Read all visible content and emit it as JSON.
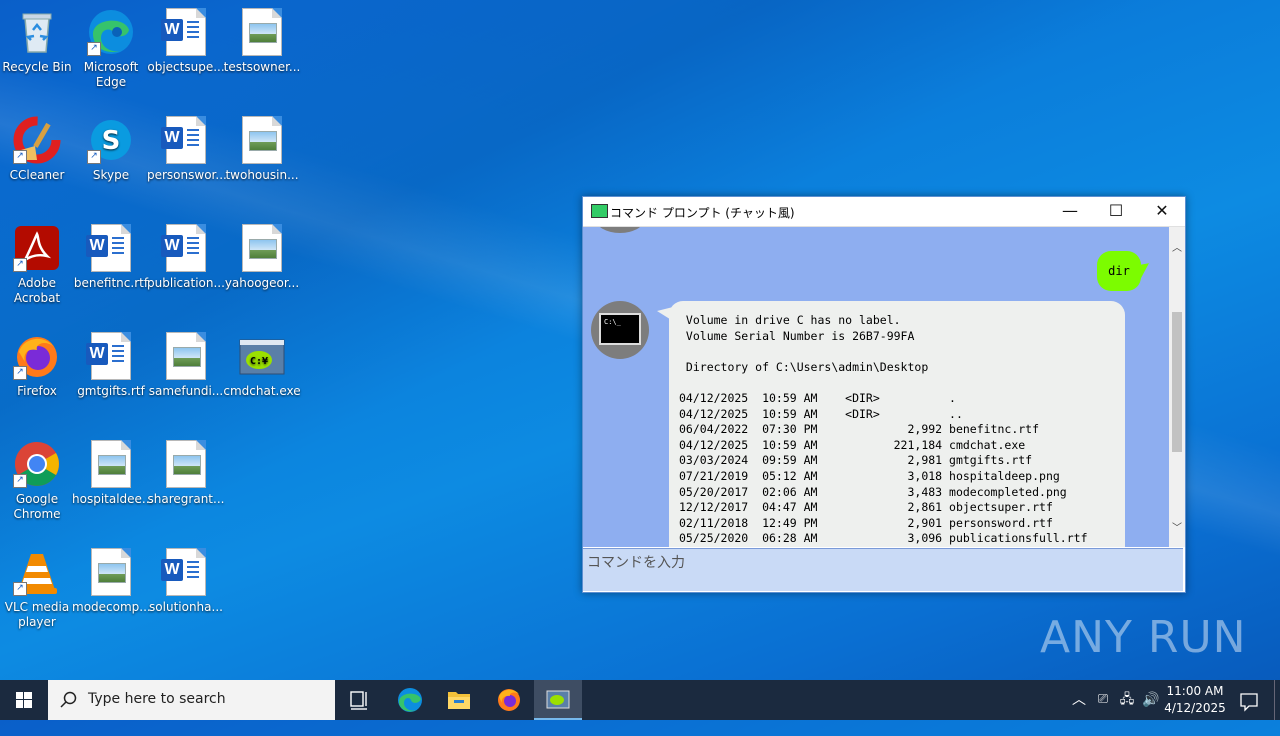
{
  "desktop": {
    "icons": [
      {
        "label": "Recycle Bin",
        "icon": "recycle-bin-icon"
      },
      {
        "label": "Microsoft\nEdge",
        "icon": "edge-icon"
      },
      {
        "label": "objectsupe...",
        "icon": "word-document-icon"
      },
      {
        "label": "testsowner...",
        "icon": "image-file-icon"
      },
      {
        "label": "CCleaner",
        "icon": "ccleaner-icon"
      },
      {
        "label": "Skype",
        "icon": "skype-icon"
      },
      {
        "label": "personswor...",
        "icon": "word-document-icon"
      },
      {
        "label": "twohousin...",
        "icon": "image-file-icon"
      },
      {
        "label": "Adobe\nAcrobat",
        "icon": "acrobat-icon"
      },
      {
        "label": "benefitnc.rtf",
        "icon": "word-document-icon"
      },
      {
        "label": "publication...",
        "icon": "word-document-icon"
      },
      {
        "label": "yahoogeor...",
        "icon": "image-file-icon"
      },
      {
        "label": "Firefox",
        "icon": "firefox-icon"
      },
      {
        "label": "gmtgifts.rtf",
        "icon": "word-document-icon"
      },
      {
        "label": "samefundi...",
        "icon": "image-file-icon"
      },
      {
        "label": "cmdchat.exe",
        "icon": "cmdchat-icon"
      },
      {
        "label": "Google\nChrome",
        "icon": "chrome-icon"
      },
      {
        "label": "hospitaldee...",
        "icon": "image-file-icon"
      },
      {
        "label": "sharegrant...",
        "icon": "image-file-icon"
      },
      {
        "label": "VLC media\nplayer",
        "icon": "vlc-icon"
      },
      {
        "label": "modecomp...",
        "icon": "image-file-icon"
      },
      {
        "label": "solutionha...",
        "icon": "word-document-icon"
      }
    ]
  },
  "window": {
    "title": "コマンド プロンプト (チャット風)",
    "user_message": "dir",
    "bot_output": " Volume in drive C has no label.\n Volume Serial Number is 26B7-99FA\n\n Directory of C:\\Users\\admin\\Desktop\n\n04/12/2025  10:59 AM    <DIR>          .\n04/12/2025  10:59 AM    <DIR>          ..\n06/04/2022  07:30 PM             2,992 benefitnc.rtf\n04/12/2025  10:59 AM           221,184 cmdchat.exe\n03/03/2024  09:59 AM             2,981 gmtgifts.rtf\n07/21/2019  05:12 AM             3,018 hospitaldeep.png\n05/20/2017  02:06 AM             3,483 modecompleted.png\n12/12/2017  04:47 AM             2,861 objectsuper.rtf\n02/11/2018  12:49 PM             2,901 personsword.rtf\n05/25/2020  06:28 AM             3,096 publicationsfull.rtf",
    "input_placeholder": "コマンドを入力",
    "cmd_icon_text": "C:\\_"
  },
  "watermark": "ANY RUN",
  "taskbar": {
    "search_placeholder": "Type here to search",
    "clock_time": "11:00 AM",
    "clock_date": "4/12/2025"
  },
  "colors": {
    "desktop_bg": "#0a78d8",
    "chat_bg": "#8eaef0",
    "user_bubble": "#7cfc00",
    "bot_bubble": "#eef0ee",
    "taskbar": "#1b2a3f"
  }
}
